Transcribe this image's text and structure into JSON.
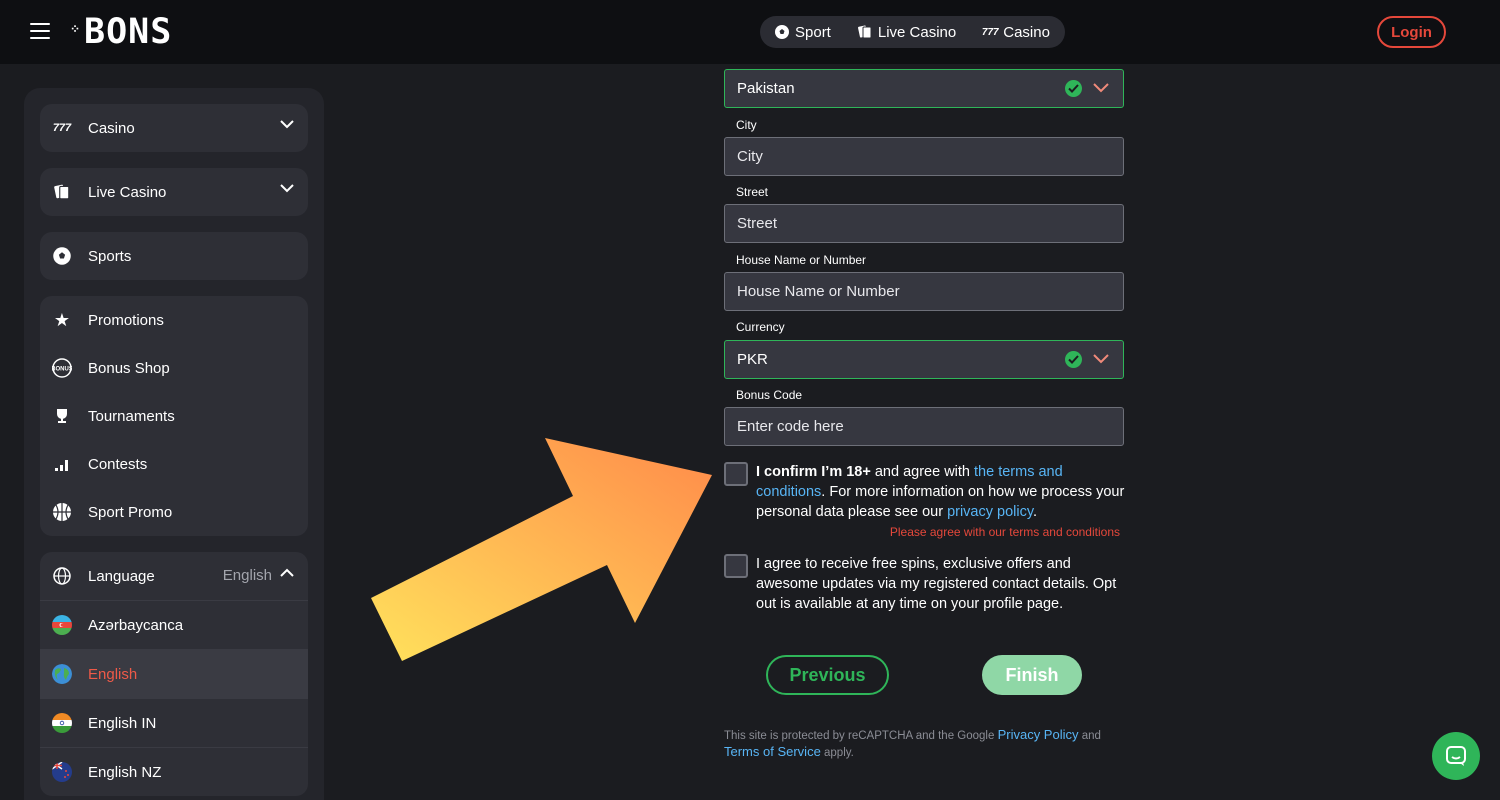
{
  "header": {
    "logo_text": "BONS",
    "nav": [
      {
        "label": "Sport",
        "icon": "soccer-ball-icon"
      },
      {
        "label": "Live Casino",
        "icon": "cards-icon"
      },
      {
        "label": "Casino",
        "icon": "slot-777-icon"
      }
    ],
    "login_label": "Login"
  },
  "sidebar": {
    "groups": [
      {
        "label": "Casino",
        "icon": "slot-777-icon",
        "expandable": true
      },
      {
        "label": "Live Casino",
        "icon": "cards-icon",
        "expandable": true
      },
      {
        "label": "Sports",
        "icon": "soccer-ball-icon",
        "expandable": false
      }
    ],
    "extras": [
      {
        "label": "Promotions",
        "icon": "star-icon"
      },
      {
        "label": "Bonus Shop",
        "icon": "bonus-badge-icon"
      },
      {
        "label": "Tournaments",
        "icon": "trophy-icon"
      },
      {
        "label": "Contests",
        "icon": "bars-icon"
      },
      {
        "label": "Sport Promo",
        "icon": "basketball-icon"
      }
    ],
    "language": {
      "label": "Language",
      "current": "English",
      "options": [
        {
          "label": "Azərbaycanca",
          "flag": "azerbaijan-flag-icon"
        },
        {
          "label": "English",
          "flag": "globe-flag-icon",
          "active": true
        },
        {
          "label": "English IN",
          "flag": "india-flag-icon"
        },
        {
          "label": "English NZ",
          "flag": "new-zealand-flag-icon"
        }
      ]
    }
  },
  "form": {
    "country_value": "Pakistan",
    "city": {
      "label": "City",
      "placeholder": "City"
    },
    "street": {
      "label": "Street",
      "placeholder": "Street"
    },
    "house": {
      "label": "House Name or Number",
      "placeholder": "House Name or Number"
    },
    "currency": {
      "label": "Currency",
      "value": "PKR"
    },
    "bonus": {
      "label": "Bonus Code",
      "placeholder": "Enter code here"
    },
    "terms": {
      "bold": "I confirm I’m 18+",
      "text1": " and agree with ",
      "terms_link": "the terms and conditions",
      "text2": ". For more information on how we process your personal data please see our ",
      "privacy_link": "privacy policy",
      "text3": ".",
      "error": "Please agree with our terms and conditions"
    },
    "marketing": "I agree to receive free spins, exclusive offers and awesome updates via my registered contact details. Opt out is available at any time on your profile page.",
    "previous_label": "Previous",
    "finish_label": "Finish",
    "recaptcha": {
      "text1": "This site is protected by reCAPTCHA and the Google ",
      "privacy": "Privacy Policy",
      "text2": " and ",
      "terms": "Terms of Service",
      "text3": " apply."
    }
  },
  "colors": {
    "accent_green": "#2fb559",
    "accent_red": "#e5483b",
    "link_blue": "#58b5f5"
  }
}
